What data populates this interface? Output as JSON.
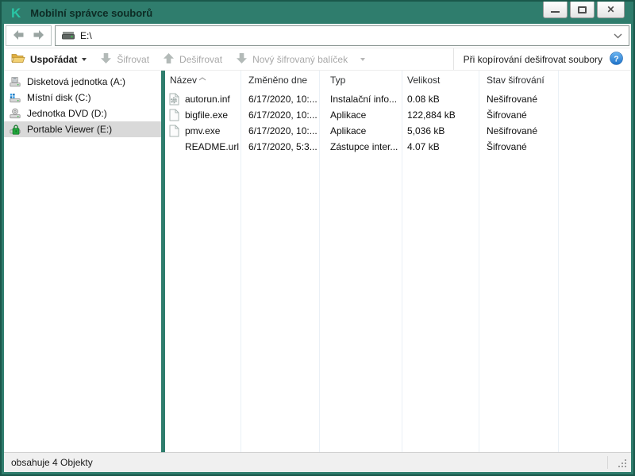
{
  "window": {
    "title": "Mobilní správce souborů",
    "logo_glyph": "K",
    "close_glyph": "✕"
  },
  "address_bar": {
    "value": "E:\\"
  },
  "toolbar": {
    "organize_label": "Uspořádat",
    "encrypt_label": "Šifrovat",
    "decrypt_label": "Dešifrovat",
    "new_package_label": "Nový šifrovaný balíček",
    "right_option_label": "Při kopírování dešifrovat soubory",
    "help_glyph": "?"
  },
  "sidebar": {
    "items": [
      {
        "label": "Disketová jednotka (A:)",
        "icon": "floppy-drive-icon",
        "selected": false
      },
      {
        "label": "Místní disk (C:)",
        "icon": "local-disk-icon",
        "selected": false
      },
      {
        "label": "Jednotka DVD (D:)",
        "icon": "dvd-drive-icon",
        "selected": false
      },
      {
        "label": "Portable Viewer (E:)",
        "icon": "encrypted-drive-icon",
        "selected": true
      }
    ]
  },
  "file_list": {
    "columns": [
      "Název",
      "Změněno dne",
      "Typ",
      "Velikost",
      "Stav šifrování"
    ],
    "sort_column": "Název",
    "sort_direction": "ascending",
    "rows": [
      {
        "icon": "setup-information-file-icon",
        "name": "autorun.inf",
        "modified": "6/17/2020, 10:...",
        "type": "Instalační info...",
        "size": "0.08 kB",
        "status": "Nešifrované"
      },
      {
        "icon": "file-icon",
        "name": "bigfile.exe",
        "modified": "6/17/2020, 10:...",
        "type": "Aplikace",
        "size": "122,884 kB",
        "status": "Šifrované"
      },
      {
        "icon": "file-icon",
        "name": "pmv.exe",
        "modified": "6/17/2020, 10:...",
        "type": "Aplikace",
        "size": "5,036 kB",
        "status": "Nešifrované"
      },
      {
        "icon": "none",
        "name": "README.url",
        "modified": "6/17/2020, 5:3...",
        "type": "Zástupce inter...",
        "size": "4.07 kB",
        "status": "Šifrované"
      }
    ]
  },
  "status_bar": {
    "text": "obsahuje 4 Objekty"
  },
  "colors": {
    "titlebar": "#2f7d6d",
    "logo_accent": "#29c5a5",
    "selection": "#d9d9d9",
    "statusbar_bg": "#f0f0f0",
    "help_icon_blue": "#2f96e8",
    "lock_green": "#21a63c"
  }
}
